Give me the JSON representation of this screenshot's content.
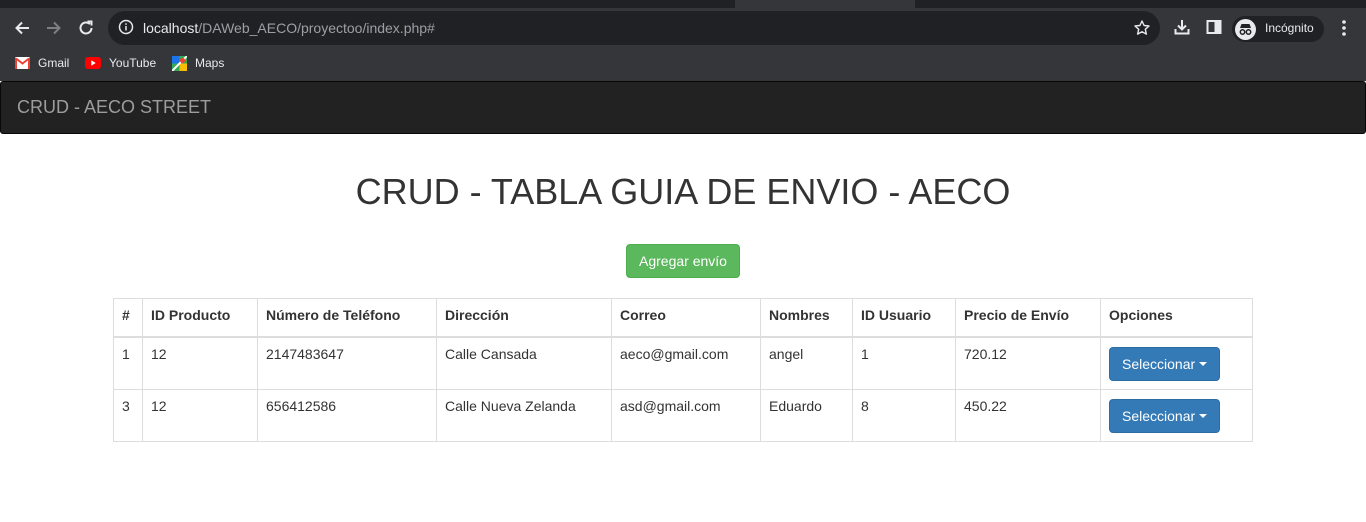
{
  "browser": {
    "url_host": "localhost",
    "url_path": "/DAWeb_AECO/proyectoo/index.php#",
    "profile_label": "Incógnito",
    "bookmarks": [
      {
        "label": "Gmail",
        "icon": "gmail-icon"
      },
      {
        "label": "YouTube",
        "icon": "youtube-icon"
      },
      {
        "label": "Maps",
        "icon": "maps-icon"
      }
    ]
  },
  "navbar": {
    "brand": "CRUD - AECO STREET"
  },
  "main": {
    "title": "CRUD - TABLA GUIA DE ENVIO - AECO",
    "add_button": "Agregar envío"
  },
  "table": {
    "headers": [
      "#",
      "ID Producto",
      "Número de Teléfono",
      "Dirección",
      "Correo",
      "Nombres",
      "ID Usuario",
      "Precio de Envío",
      "Opciones"
    ],
    "rows": [
      {
        "num": "1",
        "id_producto": "12",
        "telefono": "2147483647",
        "direccion": "Calle Cansada",
        "correo": "aeco@gmail.com",
        "nombres": "angel",
        "id_usuario": "1",
        "precio": "720.12",
        "action": "Seleccionar"
      },
      {
        "num": "3",
        "id_producto": "12",
        "telefono": "656412586",
        "direccion": "Calle Nueva Zelanda",
        "correo": "asd@gmail.com",
        "nombres": "Eduardo",
        "id_usuario": "8",
        "precio": "450.22",
        "action": "Seleccionar"
      }
    ]
  },
  "colors": {
    "chrome_bg": "#35363a",
    "navbar_bg": "#222222",
    "success": "#5cb85c",
    "primary": "#337ab7"
  }
}
